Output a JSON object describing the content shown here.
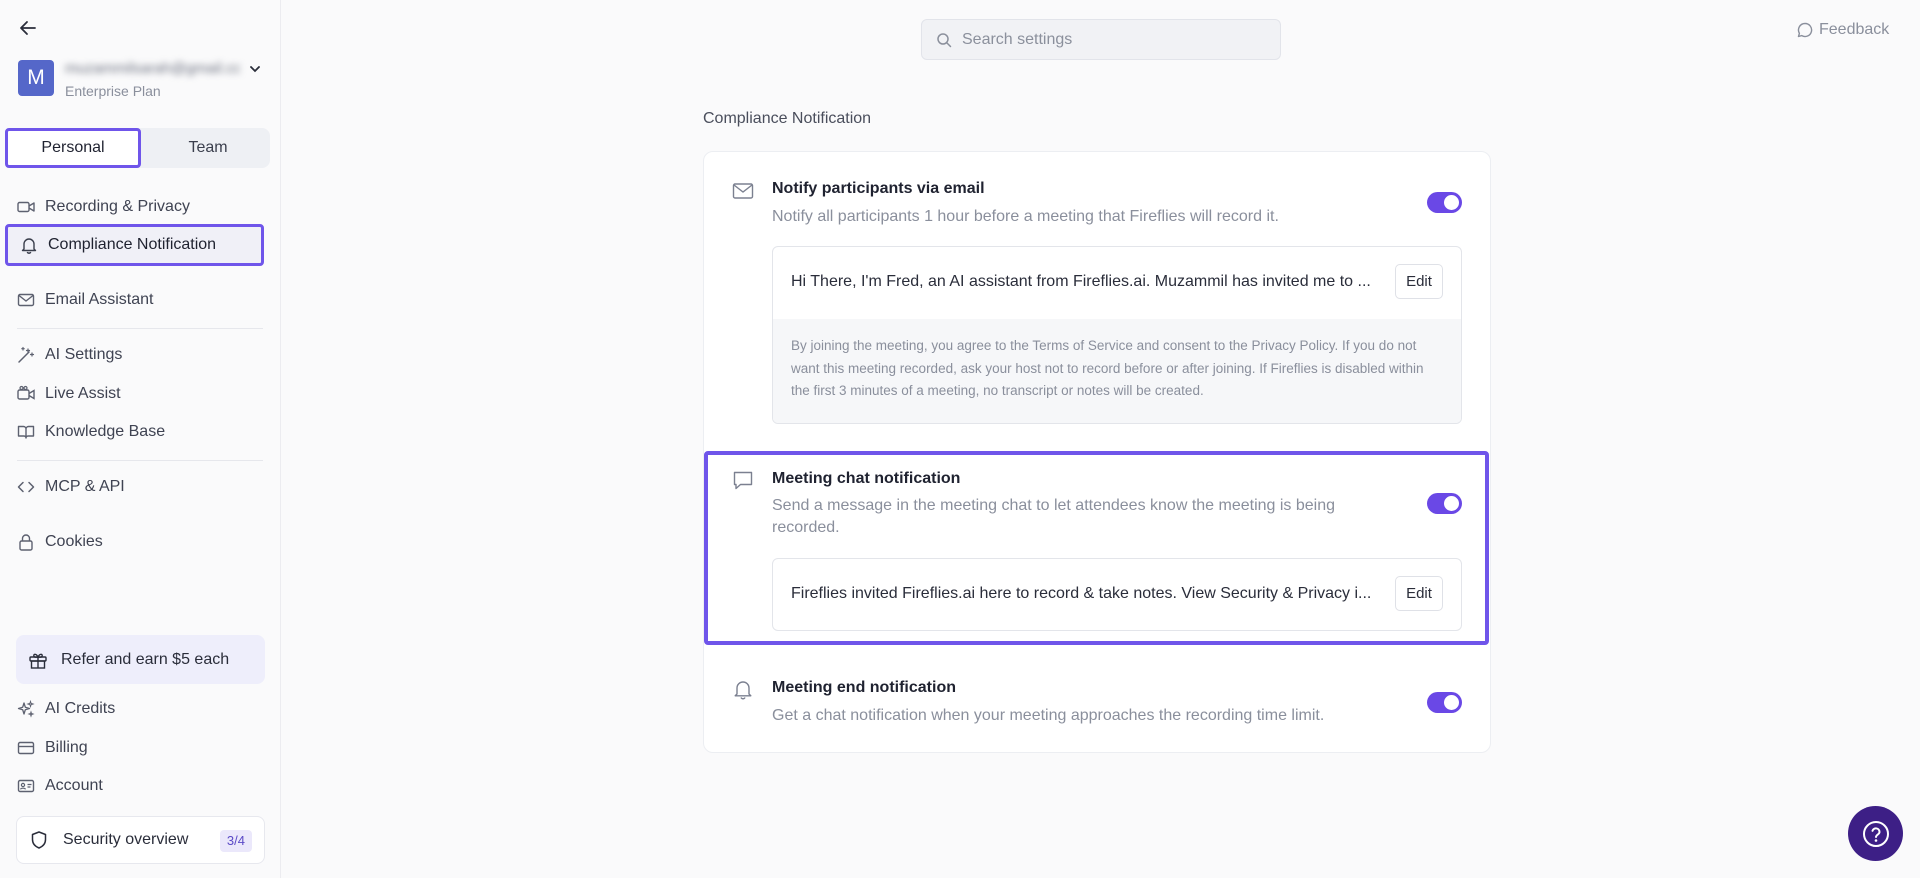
{
  "sidebar": {
    "account": {
      "avatar_letter": "M",
      "email": "muzammilsarah@gmail.com",
      "plan": "Enterprise Plan"
    },
    "tabs": {
      "personal": "Personal",
      "team": "Team",
      "active": "Personal"
    },
    "items": [
      {
        "label": "Recording & Privacy",
        "icon": "video-icon"
      },
      {
        "label": "Compliance Notification",
        "icon": "bell-icon",
        "active": true
      },
      {
        "label": "Email Assistant",
        "icon": "mail-icon"
      },
      {
        "label": "AI Settings",
        "icon": "magic-wand-icon"
      },
      {
        "label": "Live Assist",
        "icon": "video-assist-icon"
      },
      {
        "label": "Knowledge Base",
        "icon": "book-icon"
      },
      {
        "label": "MCP & API",
        "icon": "code-icon"
      },
      {
        "label": "Cookies",
        "icon": "lock-icon"
      }
    ],
    "refer": {
      "label": "Refer and earn $5 each",
      "icon": "gift-icon"
    },
    "bottom_items": [
      {
        "label": "AI Credits",
        "icon": "sparkle-icon"
      },
      {
        "label": "Billing",
        "icon": "credit-card-icon"
      },
      {
        "label": "Account",
        "icon": "id-card-icon"
      }
    ],
    "security": {
      "label": "Security overview",
      "badge": "3/4",
      "icon": "shield-icon"
    }
  },
  "header": {
    "search_placeholder": "Search settings",
    "feedback_label": "Feedback"
  },
  "main": {
    "section_title": "Compliance Notification",
    "rows": [
      {
        "title": "Notify participants via email",
        "description": "Notify all participants 1 hour before a meeting that Fireflies will record it.",
        "enabled": true,
        "message": "Hi There, I'm Fred, an AI assistant from Fireflies.ai. Muzammil has invited me to ...",
        "edit_label": "Edit",
        "disclaimer": "By joining the meeting, you agree to the Terms of Service and consent to the Privacy Policy. If you do not want this meeting recorded, ask your host not to record before or after joining. If Fireflies is disabled within the first 3 minutes of a meeting, no transcript or notes will be created."
      },
      {
        "title": "Meeting chat notification",
        "description": "Send a message in the meeting chat to let attendees know the meeting is being recorded.",
        "enabled": true,
        "message": "Fireflies invited Fireflies.ai here to record & take notes. View Security & Privacy i...",
        "edit_label": "Edit"
      },
      {
        "title": "Meeting end notification",
        "description": "Get a chat notification when your meeting approaches the recording time limit.",
        "enabled": true
      }
    ]
  },
  "colors": {
    "accent": "#6a48e6",
    "highlight": "#6f55ea",
    "help_button": "#3d1f86"
  }
}
